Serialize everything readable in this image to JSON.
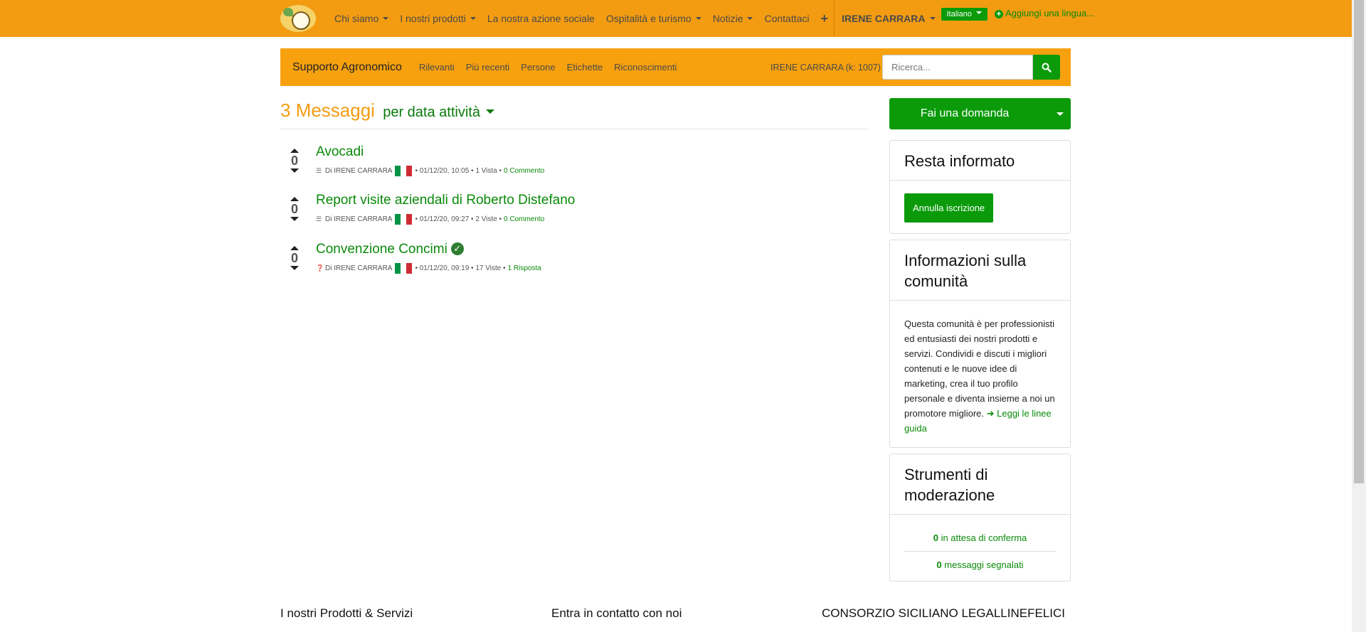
{
  "topnav": {
    "items": [
      {
        "label": "Chi siamo",
        "dropdown": true
      },
      {
        "label": "I nostri prodotti",
        "dropdown": true
      },
      {
        "label": "La nostra azione sociale",
        "dropdown": false
      },
      {
        "label": "Ospitalità e turismo",
        "dropdown": true
      },
      {
        "label": "Notizie",
        "dropdown": true
      },
      {
        "label": "Contattaci",
        "dropdown": false
      }
    ],
    "plus": "+",
    "user": "IRENE CARRARA",
    "language": "Italiano",
    "add_language": "Aggiungi una lingua..."
  },
  "forum_nav": {
    "brand": "Supporto Agronomico",
    "links": [
      "Rilevanti",
      "Più recenti",
      "Persone",
      "Etichette",
      "Riconoscimenti"
    ],
    "user_karma": "IRENE CARRARA (k: 1007)",
    "search_placeholder": "Ricerca..."
  },
  "heading": {
    "count": "3 Messaggi",
    "sort": "per data attività"
  },
  "posts": [
    {
      "votes": "0",
      "title": "Avocadi",
      "author": "Di IRENE CARRARA",
      "date": "• 01/12/20, 10:05 •",
      "views": "1 Vista •",
      "answers": "0 Commento",
      "solved": false,
      "type": "discussion"
    },
    {
      "votes": "0",
      "title": "Report visite aziendali di Roberto Distefano",
      "author": "Di IRENE CARRARA",
      "date": "• 01/12/20, 09:27 •",
      "views": "2 Viste •",
      "answers": "0 Commento",
      "solved": false,
      "type": "discussion"
    },
    {
      "votes": "0",
      "title": "Convenzione Concimi",
      "author": "Di IRENE CARRARA",
      "date": "• 01/12/20, 09:19 •",
      "views": "17 Viste •",
      "answers": "1 Risposta",
      "solved": true,
      "type": "question"
    }
  ],
  "sidebar": {
    "ask_button": "Fai una domanda",
    "stay_informed": {
      "title": "Resta informato",
      "button": "Annulla iscrizione"
    },
    "community": {
      "title": "Informazioni sulla comunità",
      "text": "Questa comunità è per professionisti ed entusiasti dei nostri prodotti e servizi. Condividi e discuti i migliori contenuti e le nuove idee di marketing, crea il tuo profilo personale e diventa insieme a noi un promotore migliore.",
      "guide_link": "Leggi le linee guida"
    },
    "moderation": {
      "title": "Strumenti di moderazione",
      "pending_count": "0",
      "pending_label": "in attesa di conferma",
      "flagged_count": "0",
      "flagged_label": "messaggi segnalati"
    }
  },
  "footer": {
    "col1": "I nostri Prodotti & Servizi",
    "col2": "Entra in contatto con noi",
    "col3": "CONSORZIO SICILIANO LEGALLINEFELICI"
  },
  "colors": {
    "primary_orange": "#f39c12",
    "brand_green": "#0a9a0a",
    "link_green": "#0a8a0a"
  }
}
